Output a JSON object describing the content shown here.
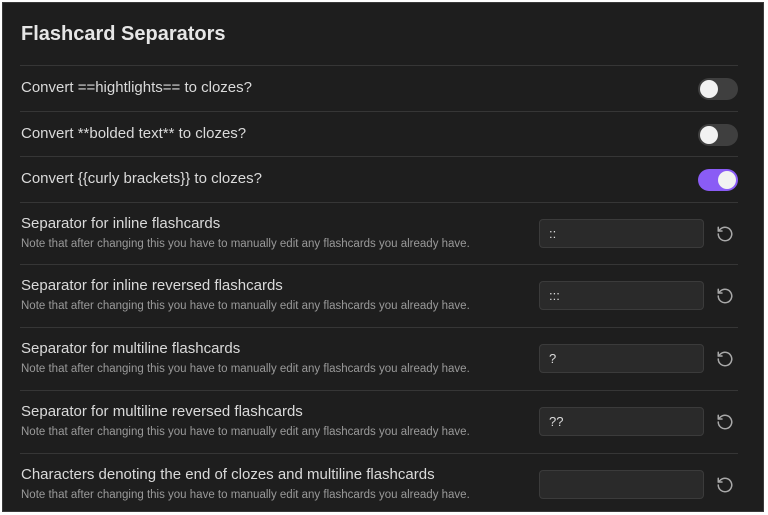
{
  "section": {
    "title": "Flashcard Separators"
  },
  "toggles": [
    {
      "label": "Convert ==hightlights== to clozes?",
      "enabled": false
    },
    {
      "label": "Convert **bolded text** to clozes?",
      "enabled": false
    },
    {
      "label": "Convert {{curly brackets}} to clozes?",
      "enabled": true
    }
  ],
  "separators": [
    {
      "label": "Separator for inline flashcards",
      "description": "Note that after changing this you have to manually edit any flashcards you already have.",
      "value": "::",
      "reset_icon": "reset-icon"
    },
    {
      "label": "Separator for inline reversed flashcards",
      "description": "Note that after changing this you have to manually edit any flashcards you already have.",
      "value": ":::",
      "reset_icon": "reset-icon"
    },
    {
      "label": "Separator for multiline flashcards",
      "description": "Note that after changing this you have to manually edit any flashcards you already have.",
      "value": "?",
      "reset_icon": "reset-icon"
    },
    {
      "label": "Separator for multiline reversed flashcards",
      "description": "Note that after changing this you have to manually edit any flashcards you already have.",
      "value": "??",
      "reset_icon": "reset-icon"
    },
    {
      "label": "Characters denoting the end of clozes and multiline flashcards",
      "description": "Note that after changing this you have to manually edit any flashcards you already have.",
      "value": "",
      "reset_icon": "reset-icon"
    }
  ],
  "colors": {
    "background": "#1e1e1e",
    "accent": "#8a5cf5",
    "toggle_off": "#3f3f3f"
  }
}
